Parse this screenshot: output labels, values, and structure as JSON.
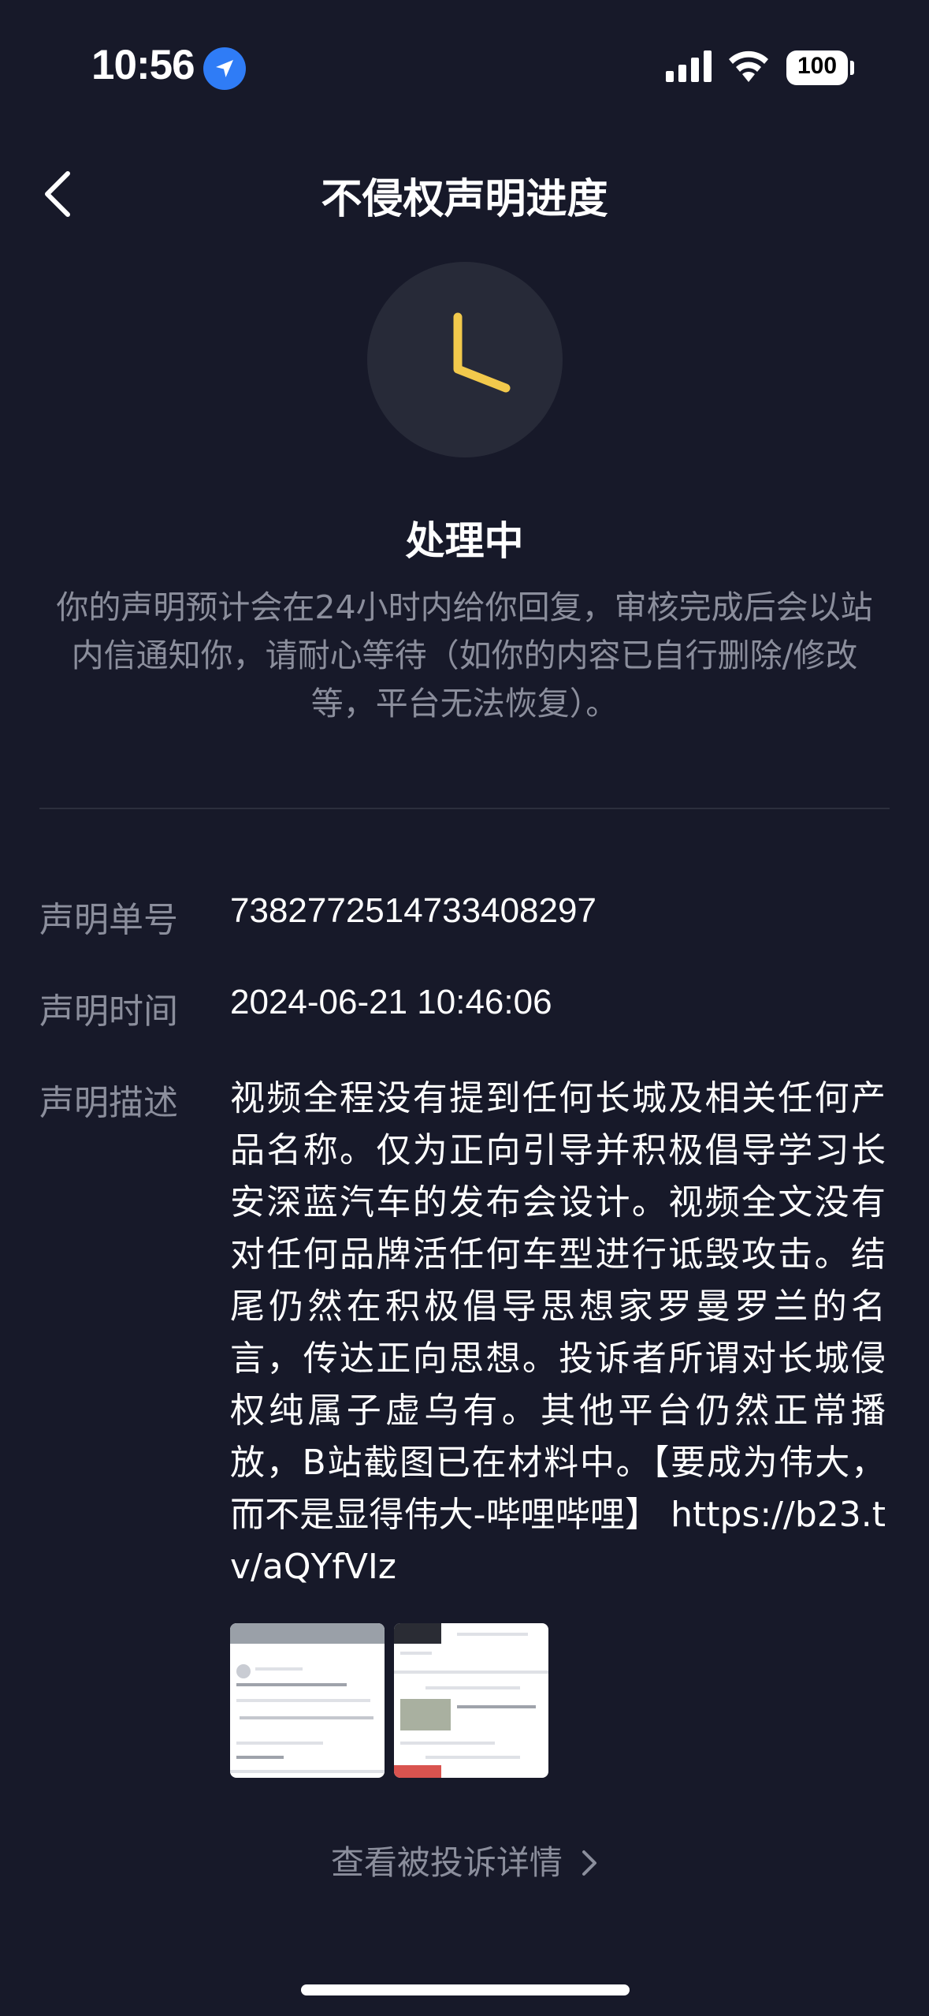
{
  "status_bar": {
    "time": "10:56",
    "battery": "100",
    "icons": [
      "location-arrow-icon",
      "cellular-signal-icon",
      "wifi-icon",
      "battery-icon"
    ]
  },
  "nav": {
    "back_icon": "chevron-left-icon",
    "title": "不侵权声明进度"
  },
  "status": {
    "icon": "clock-icon",
    "accent_color": "#f2c94c",
    "title": "处理中",
    "description": "你的声明预计会在24小时内给你回复，审核完成后会以站内信通知你，请耐心等待（如你的内容已自行删除/修改等，平台无法恢复）。"
  },
  "details": {
    "number_label": "声明单号",
    "number_value": "7382772514733408297",
    "time_label": "声明时间",
    "time_value": "2024-06-21 10:46:06",
    "desc_label": "声明描述",
    "desc_value": "视频全程没有提到任何长城及相关任何产品名称。仅为正向引导并积极倡导学习长安深蓝汽车的发布会设计。视频全文没有对任何品牌活任何车型进行诋毁攻击。结尾仍然在积极倡导思想家罗曼罗兰的名言，传达正向思想。投诉者所谓对长城侵权纯属子虚乌有。其他平台仍然正常播放，B站截图已在材料中。【要成为伟大，而不是显得伟大-哔哩哔哩】 https://b23.tv/aQYfVIz"
  },
  "attachments": [
    {
      "name": "screenshot-1"
    },
    {
      "name": "screenshot-2"
    }
  ],
  "footer": {
    "link_label": "查看被投诉详情",
    "link_icon": "chevron-right-icon"
  }
}
